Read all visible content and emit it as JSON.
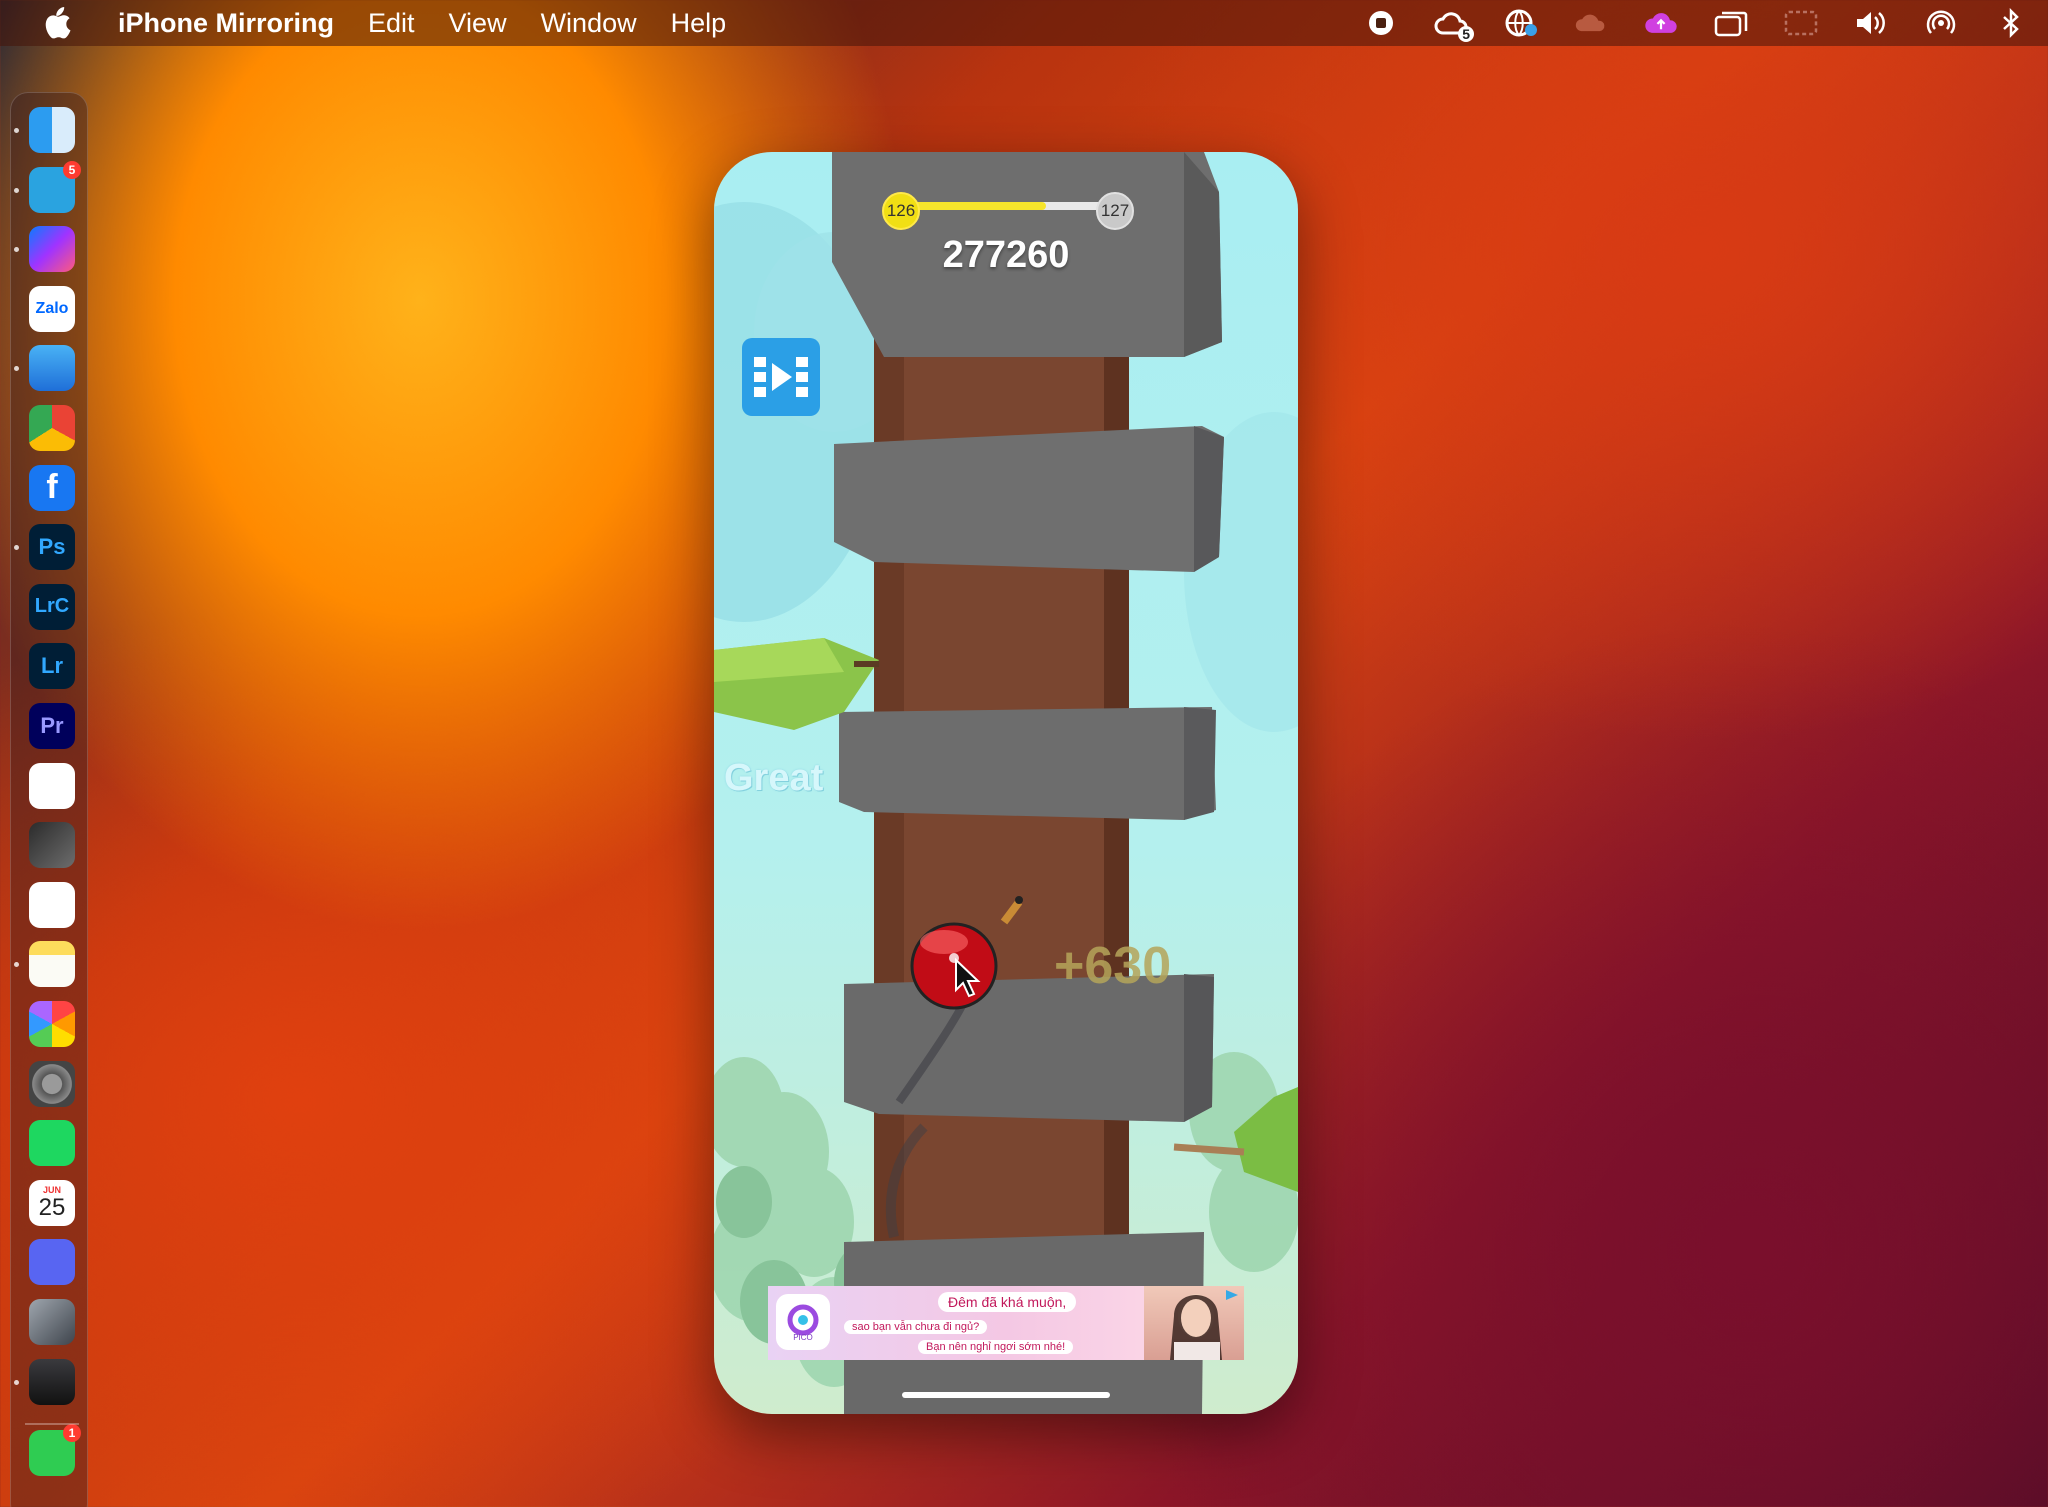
{
  "menubar": {
    "app_name": "iPhone Mirroring",
    "items": [
      "Edit",
      "View",
      "Window",
      "Help"
    ],
    "status_icons": [
      "record-icon",
      "creative-cloud-icon",
      "network-icon",
      "cloud-icon",
      "cloud-sync-icon",
      "screen-mirroring-icon",
      "display-icon",
      "volume-icon",
      "airdrop-icon",
      "bluetooth-icon"
    ],
    "cc_badge": "5"
  },
  "dock": {
    "apps": [
      {
        "name": "finder",
        "label": ""
      },
      {
        "name": "telegram",
        "label": "",
        "badge": "5"
      },
      {
        "name": "messenger",
        "label": ""
      },
      {
        "name": "zalo",
        "label": "Zalo"
      },
      {
        "name": "safari",
        "label": ""
      },
      {
        "name": "chrome",
        "label": ""
      },
      {
        "name": "facebook",
        "label": "f"
      },
      {
        "name": "photoshop",
        "label": "Ps"
      },
      {
        "name": "lightroom-classic",
        "label": "LrC"
      },
      {
        "name": "lightroom",
        "label": "Lr"
      },
      {
        "name": "premiere-pro",
        "label": "Pr"
      },
      {
        "name": "capcut",
        "label": ""
      },
      {
        "name": "final-cut",
        "label": ""
      },
      {
        "name": "freeform",
        "label": ""
      },
      {
        "name": "notes",
        "label": ""
      },
      {
        "name": "photos",
        "label": ""
      },
      {
        "name": "system-settings",
        "label": ""
      },
      {
        "name": "spotify",
        "label": ""
      },
      {
        "name": "calendar",
        "label": "25",
        "month": "JUN"
      },
      {
        "name": "discord",
        "label": ""
      },
      {
        "name": "utilities",
        "label": ""
      },
      {
        "name": "iphone-mirroring",
        "label": ""
      },
      {
        "name": "facetime",
        "label": "",
        "badge": "1"
      }
    ]
  },
  "game": {
    "level_current": "126",
    "level_next": "127",
    "progress": 0.72,
    "score": "277260",
    "feedback": "Great",
    "points_popup": "+630"
  },
  "ad": {
    "title": "Đêm đã khá muộn,",
    "line1": "sao bạn vẫn chưa đi ngủ?",
    "line2": "Bạn nên nghỉ ngơi sớm nhé!",
    "logo_text": "PICO"
  },
  "colors": {
    "sky": "#a9eef2",
    "trunk": "#7a4630",
    "rings": "#6b6b6b",
    "ball": "#d3101a",
    "accent_blue": "#2b9fe6",
    "progress": "#f7e52b"
  }
}
